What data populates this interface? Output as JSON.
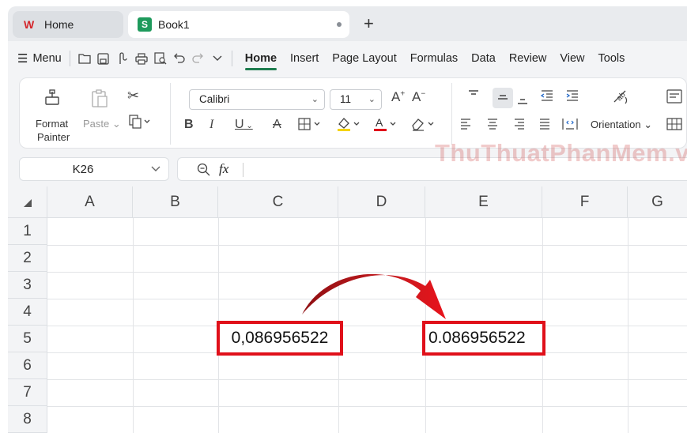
{
  "tabs": {
    "home_label": "Home",
    "book_label": "Book1",
    "new_tab_symbol": "+"
  },
  "menu": {
    "menu_label": "Menu",
    "tabs": [
      "Home",
      "Insert",
      "Page Layout",
      "Formulas",
      "Data",
      "Review",
      "View",
      "Tools"
    ]
  },
  "ribbon": {
    "format_painter_line1": "Format",
    "format_painter_line2": "Painter",
    "paste_label": "Paste",
    "font_name": "Calibri",
    "font_size": "11",
    "orientation_label": "Orientation"
  },
  "formula_bar": {
    "cell_ref": "K26",
    "fx_label": "fx"
  },
  "watermark": "ThuThuatPhanMem.vn",
  "grid": {
    "columns": [
      "A",
      "B",
      "C",
      "D",
      "E",
      "F",
      "G"
    ],
    "rows": [
      "1",
      "2",
      "3",
      "4",
      "5",
      "6",
      "7",
      "8"
    ]
  },
  "annotations": {
    "before_value": "0,086956522",
    "after_value": "0.086956522"
  },
  "colors": {
    "accent": "#1e7d4f",
    "highlight_red": "#e0101a",
    "wps_red": "#d4262b"
  }
}
